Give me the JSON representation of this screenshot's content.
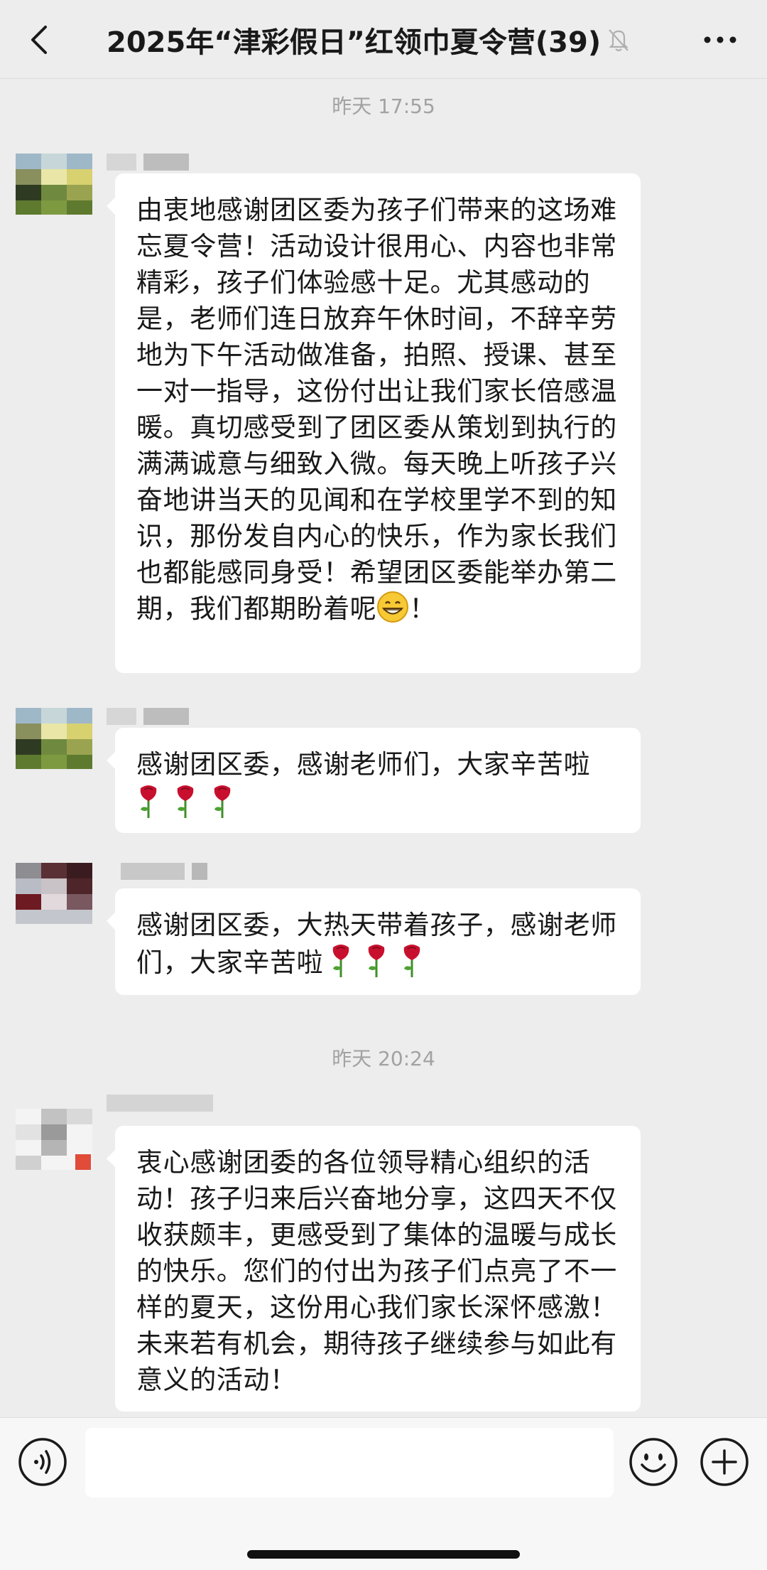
{
  "header": {
    "title": "2025年“津彩假日”红领巾夏令营(39)"
  },
  "timestamps": [
    "昨天 17:55",
    "昨天 20:24"
  ],
  "messages": [
    {
      "text": "由衷地感谢团区委为孩子们带来的这场难忘夏令营！活动设计很用心、内容也非常精彩，孩子们体验感十足。尤其感动的是，老师们连日放弃午休时间，不辞辛劳地为下午活动做准备，拍照、授课、甚至一对一指导，这份付出让我们家长倍感温暖。真切感受到了团区委从策划到执行的满满诚意与细致入微。每天晚上听孩子兴奋地讲当天的见闻和在学校里学不到的知识，那份发自内心的快乐，作为家长我们也都能感同身受！希望团区委能举办第二期，我们都期盼着呢",
      "text_tail": "！"
    },
    {
      "text": "感谢团区委，感谢老师们，大家辛苦啦"
    },
    {
      "text": "感谢团区委，大热天带着孩子，感谢老师们，大家辛苦啦"
    },
    {
      "text": "衷心感谢团委的各位领导精心组织的活动！孩子归来后兴奋地分享，这四天不仅收获颇丰，更感受到了集体的温暖与成长的快乐。您们的付出为孩子们点亮了不一样的夏天，这份用心我们家长深怀感激！未来若有机会，期待孩子继续参与如此有意义的活动！"
    }
  ],
  "icons": {
    "back": "chevron-left-icon",
    "mute": "bell-off-icon",
    "more": "more-dots-icon",
    "voice": "voice-icon",
    "emoji": "smile-icon",
    "plus": "plus-icon",
    "grin": "grin-emoji-icon",
    "rose": "rose-emoji-icon"
  },
  "colors": {
    "background": "#ededed",
    "bubble": "#ffffff",
    "text": "#191919",
    "timestamp": "#a2a2a2",
    "rose": "#c8102e"
  }
}
